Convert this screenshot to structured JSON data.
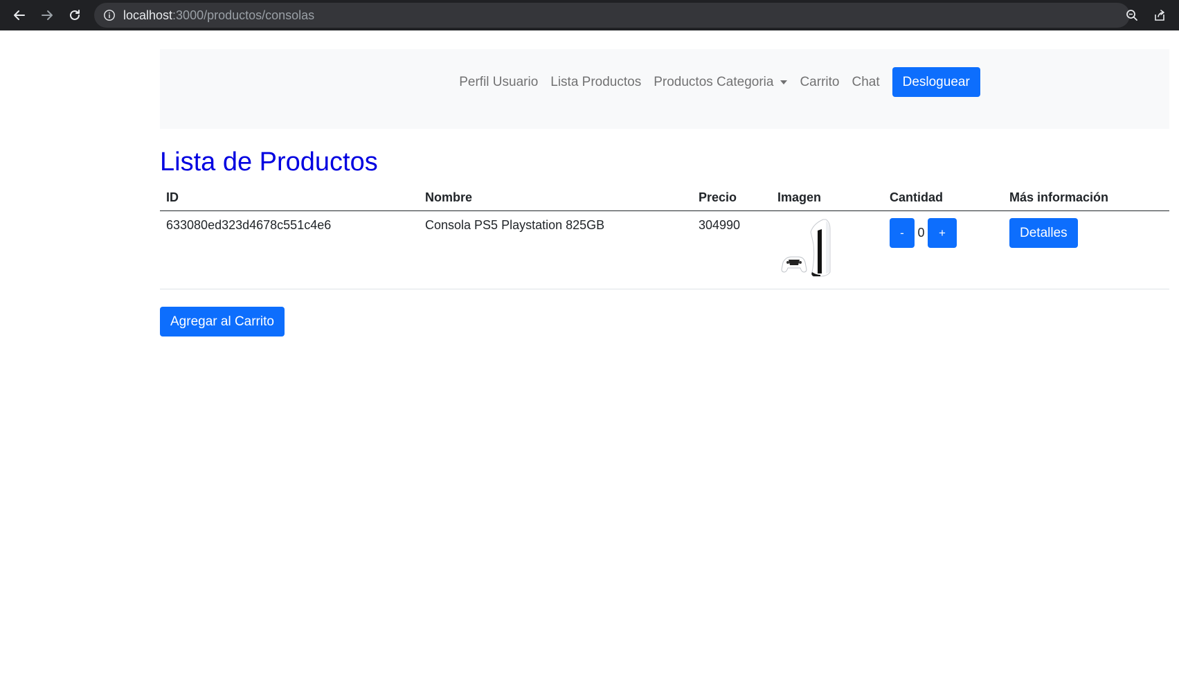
{
  "browser": {
    "url_host": "localhost",
    "url_path": ":3000/productos/consolas",
    "icons": [
      "back-arrow-icon",
      "forward-arrow-icon",
      "reload-icon",
      "info-icon",
      "zoom-icon",
      "share-icon"
    ]
  },
  "navbar": {
    "items": [
      {
        "label": "Perfil Usuario"
      },
      {
        "label": "Lista Productos"
      },
      {
        "label": "Productos Categoria",
        "dropdown": true
      },
      {
        "label": "Carrito"
      },
      {
        "label": "Chat"
      }
    ],
    "logout_label": "Desloguear"
  },
  "page": {
    "title": "Lista de Productos"
  },
  "table": {
    "headers": [
      "ID",
      "Nombre",
      "Precio",
      "Imagen",
      "Cantidad",
      "Más información"
    ],
    "rows": [
      {
        "id": "633080ed323d4678c551c4e6",
        "name": "Consola PS5 Playstation 825GB",
        "price": "304990",
        "quantity": "0",
        "minus_label": "-",
        "plus_label": "+",
        "details_label": "Detalles"
      }
    ]
  },
  "actions": {
    "add_to_cart_label": "Agregar al Carrito"
  },
  "colors": {
    "primary": "#0d6efd",
    "title": "#0000e0",
    "navbar_bg": "#f8f9fa",
    "chrome_bg": "#202124"
  }
}
